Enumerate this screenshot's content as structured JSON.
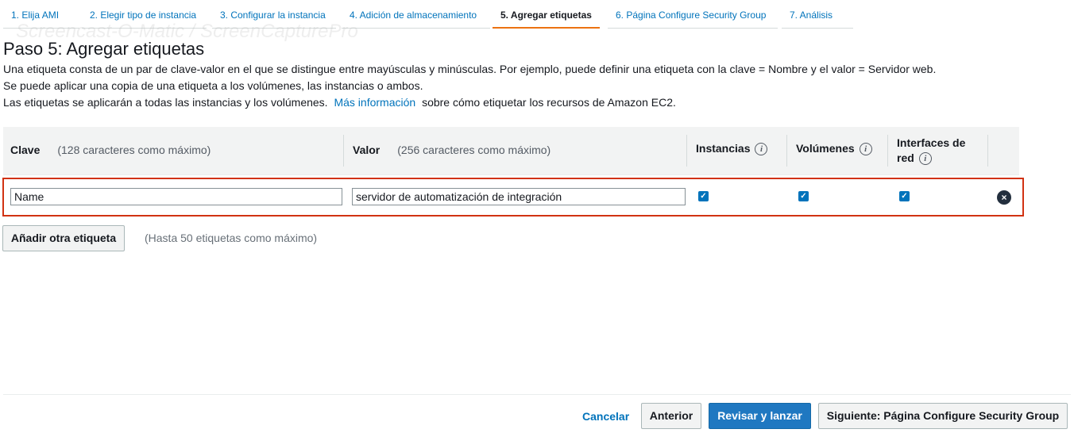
{
  "wizard": {
    "tabs": [
      {
        "label": "1. Elija AMI"
      },
      {
        "label": "2. Elegir tipo de instancia"
      },
      {
        "label": "3. Configurar la instancia"
      },
      {
        "label": "4. Adición de almacenamiento"
      },
      {
        "label": "5. Agregar etiquetas",
        "active": true
      },
      {
        "label": "6. Página Configure Security Group"
      },
      {
        "label": "7. Análisis"
      }
    ]
  },
  "watermark": "Screencast-O-Matic / ScreenCapturePro",
  "page": {
    "title": "Paso 5: Agregar etiquetas",
    "desc1": "Una etiqueta consta de un par de clave-valor en el que se distingue entre mayúsculas y minúsculas. Por ejemplo, puede definir una etiqueta con la clave = Nombre y el valor = Servidor web.",
    "desc2": "Se puede aplicar una copia de una etiqueta a los volúmenes, las instancias o ambos.",
    "desc3_pre": "Las etiquetas se aplicarán a todas las instancias y los volúmenes.",
    "desc3_link": "Más información",
    "desc3_post": "sobre cómo etiquetar los recursos de Amazon EC2."
  },
  "table": {
    "headers": {
      "key": "Clave",
      "key_hint": "(128 caracteres como máximo)",
      "value": "Valor",
      "value_hint": "(256 caracteres como máximo)",
      "instances": "Instancias",
      "volumes": "Volúmenes",
      "interfaces_line1": "Interfaces de",
      "interfaces_line2": "red"
    },
    "info_glyph": "i",
    "rows": [
      {
        "key": "Name",
        "value": "servidor de automatización de integración",
        "instances": true,
        "volumes": true,
        "interfaces": true
      }
    ],
    "check_glyph": "✓",
    "remove_glyph": "×"
  },
  "actions": {
    "add_tag": "Añadir otra etiqueta",
    "add_tag_hint": "(Hasta 50 etiquetas como máximo)",
    "cancel": "Cancelar",
    "previous": "Anterior",
    "review_launch": "Revisar y lanzar",
    "next": "Siguiente: Página Configure Security Group"
  },
  "colors": {
    "accent": "#ec7211",
    "link": "#0073bb",
    "primary_button": "#1f78c1",
    "highlight_border": "#d13212"
  },
  "icons": {
    "info": "info-circle-icon",
    "checkbox": "checkbox-checked-icon",
    "remove": "remove-circle-icon"
  }
}
